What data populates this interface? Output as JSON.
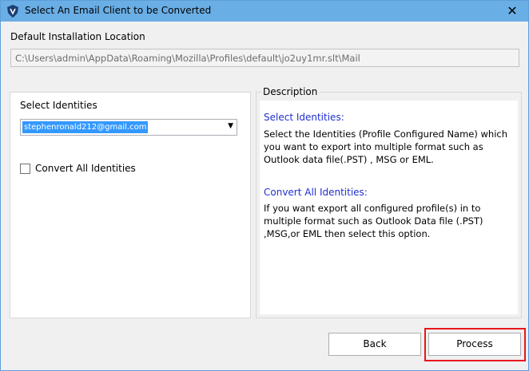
{
  "window": {
    "title": "Select An Email Client to be Converted",
    "close_glyph": "✕"
  },
  "install": {
    "label": "Default Installation Location",
    "path": "C:\\Users\\admin\\AppData\\Roaming\\Mozilla\\Profiles\\default\\jo2uy1mr.slt\\Mail"
  },
  "identities": {
    "label": "Select Identities",
    "selected": "stephenronald212@gmail.com",
    "arrow_glyph": "▼",
    "convert_all_label": "Convert All Identities",
    "convert_all_checked": false
  },
  "description": {
    "legend": "Description",
    "sections": [
      {
        "heading": "Select Identities:",
        "body": "Select the Identities (Profile Configured Name) which you want to export into multiple format such as Outlook data file(.PST) , MSG or EML."
      },
      {
        "heading": "Convert All Identities:",
        "body": "If you want export all configured profile(s) in to multiple format such as Outlook Data file (.PST) ,MSG,or EML then select this option."
      }
    ]
  },
  "buttons": {
    "back": "Back",
    "process": "Process"
  },
  "colors": {
    "titlebar": "#6aaee6",
    "heading_blue": "#1f2fd0",
    "highlight_red": "#e8161c",
    "selection_blue": "#3399ff"
  }
}
